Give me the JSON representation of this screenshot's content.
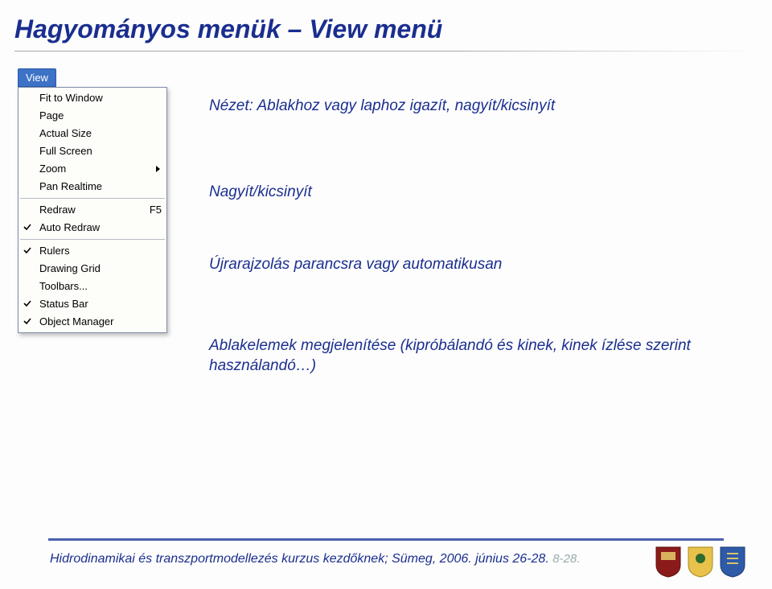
{
  "title": "Hagyományos menük – View menü",
  "menu": {
    "tab": "View",
    "groups": [
      [
        {
          "label": "Fit to Window",
          "checked": false,
          "arrow": false,
          "shortcut": ""
        },
        {
          "label": "Page",
          "checked": false,
          "arrow": false,
          "shortcut": ""
        },
        {
          "label": "Actual Size",
          "checked": false,
          "arrow": false,
          "shortcut": ""
        },
        {
          "label": "Full Screen",
          "checked": false,
          "arrow": false,
          "shortcut": ""
        },
        {
          "label": "Zoom",
          "checked": false,
          "arrow": true,
          "shortcut": ""
        },
        {
          "label": "Pan Realtime",
          "checked": false,
          "arrow": false,
          "shortcut": ""
        }
      ],
      [
        {
          "label": "Redraw",
          "checked": false,
          "arrow": false,
          "shortcut": "F5"
        },
        {
          "label": "Auto Redraw",
          "checked": true,
          "arrow": false,
          "shortcut": ""
        }
      ],
      [
        {
          "label": "Rulers",
          "checked": true,
          "arrow": false,
          "shortcut": ""
        },
        {
          "label": "Drawing Grid",
          "checked": false,
          "arrow": false,
          "shortcut": ""
        },
        {
          "label": "Toolbars...",
          "checked": false,
          "arrow": false,
          "shortcut": ""
        },
        {
          "label": "Status Bar",
          "checked": true,
          "arrow": false,
          "shortcut": ""
        },
        {
          "label": "Object Manager",
          "checked": true,
          "arrow": false,
          "shortcut": ""
        }
      ]
    ]
  },
  "annotations": {
    "a1": "Nézet: Ablakhoz vagy laphoz igazít, nagyít/kicsinyít",
    "a2": "Nagyít/kicsinyít",
    "a3": "Újrarajzolás parancsra vagy automatikusan",
    "a4": "Ablakelemek megjelenítése (kipróbálandó és kinek, kinek ízlése szerint használandó…)"
  },
  "footer": {
    "text": "Hidrodinamikai és transzportmodellezés kurzus kezdőknek; Sümeg, 2006. június 26-28.",
    "suffix": "8-28."
  },
  "logos": {
    "logo1_name": "university-shield-red",
    "logo2_name": "university-shield-yellow",
    "logo3_name": "university-shield-blue"
  }
}
